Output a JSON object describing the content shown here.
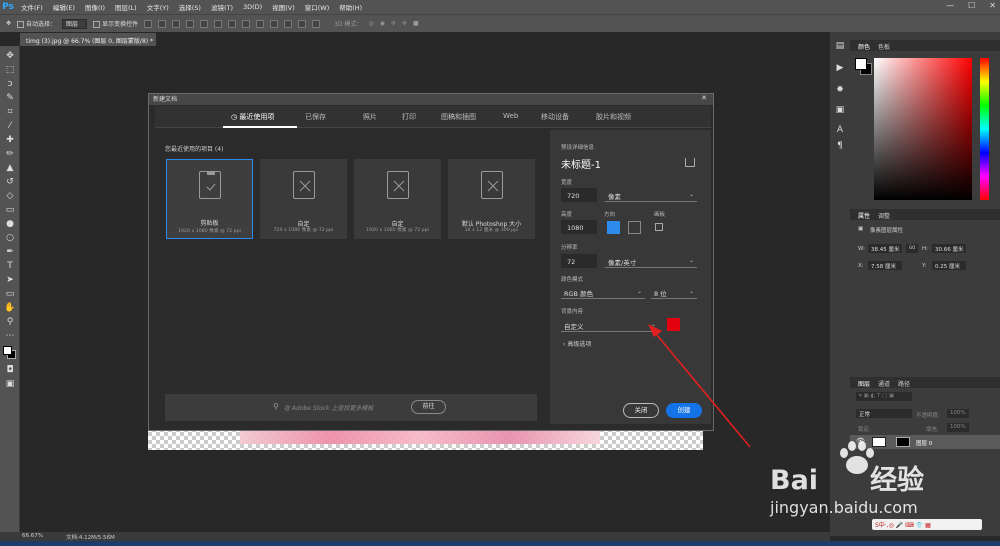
{
  "app": {
    "logo": "Ps"
  },
  "menu": [
    "文件(F)",
    "编辑(E)",
    "图像(I)",
    "图层(L)",
    "文字(Y)",
    "选择(S)",
    "滤镜(T)",
    "3D(D)",
    "视图(V)",
    "窗口(W)",
    "帮助(H)"
  ],
  "window_controls": [
    "—",
    "☐",
    "✕"
  ],
  "options_bar": {
    "auto_select": "自动选择：",
    "auto_select_value": "图层",
    "show_transform": "显示变换控件",
    "mode_3d": "3D 模式："
  },
  "doc_tab": {
    "title": "timg (3).jpg @ 66.7% (图层 0, 图层蒙版/8) *",
    "close": "×"
  },
  "dialog": {
    "title": "新建文档",
    "close": "✕",
    "tabs": [
      "最近使用项",
      "已保存",
      "照片",
      "打印",
      "图稿和插图",
      "Web",
      "移动设备",
      "胶片和视频"
    ],
    "recent_title": "您最近使用的项目 (4)",
    "cards": [
      {
        "name": "剪贴板",
        "size": "1920 x 1080 像素 @ 72 ppi"
      },
      {
        "name": "自定",
        "size": "720 x 1080 像素 @ 72 ppi"
      },
      {
        "name": "自定",
        "size": "1920 x 1080 像素 @ 72 ppi"
      },
      {
        "name": "默认 Photoshop 大小",
        "size": "16 x 12 厘米 @ 300 ppi"
      }
    ],
    "search_placeholder": "在 Adobe Stock 上查找更多模板",
    "goto_label": "前往",
    "details": {
      "section": "预设详细信息",
      "doc_name": "未标题-1",
      "width_label": "宽度",
      "width": "720",
      "width_unit": "像素",
      "height_label": "高度",
      "height": "1080",
      "orient_label": "方向",
      "artboard_label": "画板",
      "resolution_label": "分辨率",
      "resolution": "72",
      "resolution_unit": "像素/英寸",
      "color_mode_label": "颜色模式",
      "color_mode": "RGB 颜色",
      "bit_depth": "8 位",
      "bg_label": "背景内容",
      "bg_value": "自定义",
      "bg_color": "#e3000f",
      "advanced": "高级选项"
    },
    "close_label": "关闭",
    "create_label": "创建"
  },
  "panels": {
    "color_tabs": [
      "颜色",
      "色板"
    ],
    "properties_tabs": [
      "属性",
      "调整"
    ],
    "properties_title": "像素图层属性",
    "w_label": "W:",
    "w_value": "38.45 厘米",
    "h_label": "H:",
    "h_value": "30.66 厘米",
    "x_label": "X:",
    "x_value": "7.58 厘米",
    "y_label": "Y:",
    "y_value": "0.25 厘米",
    "go_label": "GO",
    "layers_tabs": [
      "图层",
      "通道",
      "路径"
    ],
    "blend_mode": "正常",
    "opacity_label": "不透明度:",
    "opacity": "100%",
    "lock_label": "锁定:",
    "fill_label": "填充:",
    "fill": "100%",
    "layer_name": "图层 0"
  },
  "status": {
    "zoom": "66.67%",
    "doc_info": "文档:4.12M/5.56M"
  },
  "watermark": {
    "logo_left": "Bai",
    "logo_right": "经验",
    "url": "jingyan.baidu.com",
    "ime": "S中·,◎ 🎤 ⌨ 👕 ▦"
  }
}
